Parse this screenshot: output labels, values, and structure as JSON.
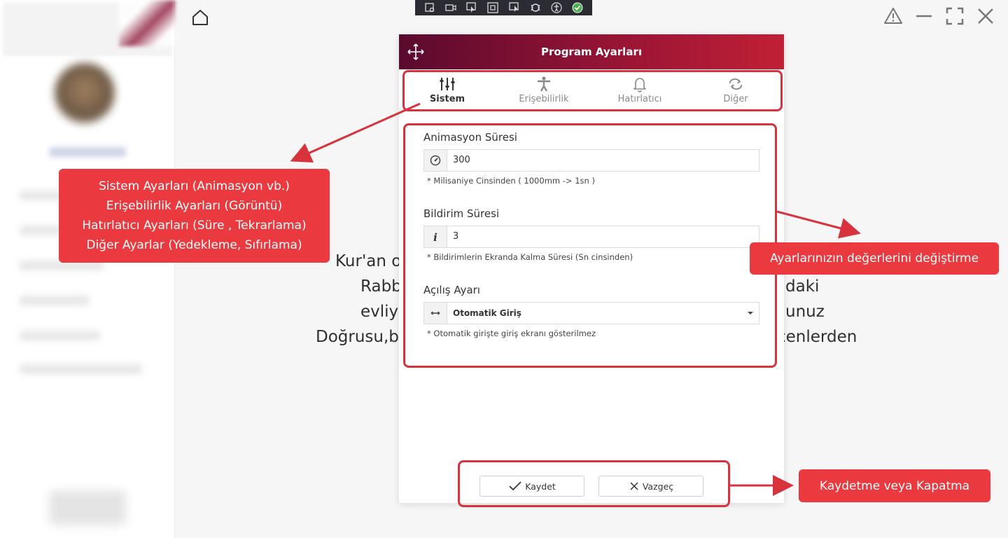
{
  "dialog": {
    "title": "Program Ayarları",
    "tabs": [
      {
        "label": "Sistem",
        "icon": "sliders-icon",
        "active": true
      },
      {
        "label": "Erişebilirlik",
        "icon": "person-icon",
        "active": false
      },
      {
        "label": "Hatırlatıcı",
        "icon": "bell-icon",
        "active": false
      },
      {
        "label": "Diğer",
        "icon": "refresh-icon",
        "active": false
      }
    ],
    "fields": [
      {
        "label": "Animasyon Süresi",
        "value": "300",
        "hint": "* Milisaniye Cinsinden ( 1000mm -> 1sn )",
        "icon": "speedometer-icon"
      },
      {
        "label": "Bildirim Süresi",
        "value": "3",
        "hint": "* Bildirimlerin Ekranda Kalma Süresi (Sn cinsinden)",
        "icon": "info-icon"
      },
      {
        "label": "Açılış Ayarı",
        "value": "Otomatik Giriş",
        "hint": "* Otomatik girişte giriş ekranı gösterilmez",
        "icon": "arrows-horizontal-icon"
      }
    ],
    "buttons": {
      "save": "Kaydet",
      "cancel": "Vazgeç"
    }
  },
  "background_text": {
    "line1": "Kur'an o",
    "line2a": "Rabb",
    "line2b": "daki",
    "line3a": "evliy",
    "line3b": "unuz",
    "line4a": "Doğrusu,b",
    "line4b": "çenlerden"
  },
  "callouts": {
    "tabs_lines": [
      "Sistem Ayarları (Animasyon vb.)",
      "Erişebilirlik Ayarları (Görüntü)",
      "Hatırlatıcı Ayarları (Süre , Tekrarlama)",
      "Diğer Ayarlar (Yedekleme, Sıfırlama)"
    ],
    "fields": "Ayarlarınızın değerlerini değiştirme",
    "buttons": "Kaydetme veya Kapatma"
  },
  "colors": {
    "header_start": "#5a0a2e",
    "header_end": "#c12035",
    "annotation": "#ea3a40",
    "highlight_border": "#d8323c"
  }
}
